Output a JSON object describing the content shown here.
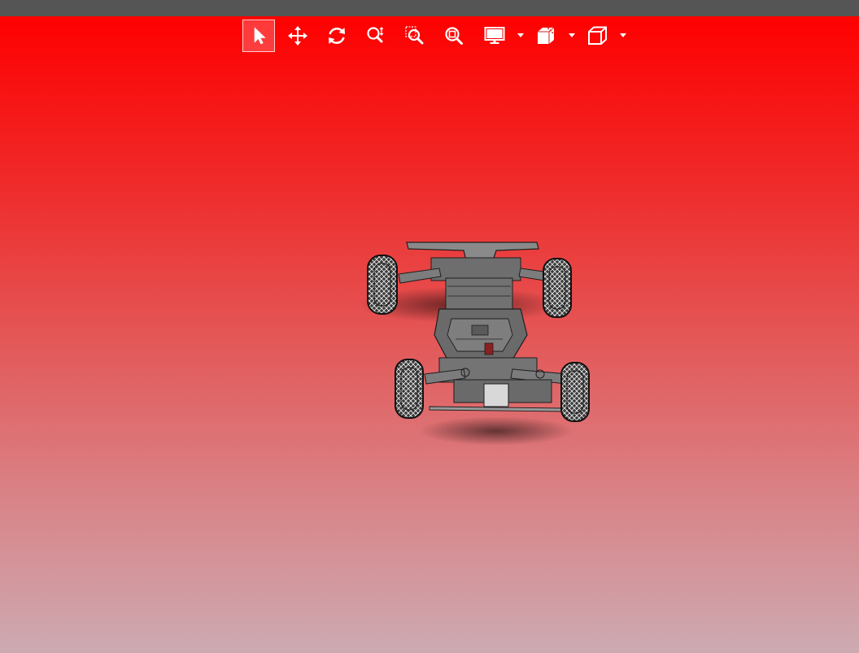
{
  "toolbar": {
    "tools": [
      {
        "name": "select",
        "icon": "select-arrow-icon",
        "active": true
      },
      {
        "name": "pan",
        "icon": "pan-icon"
      },
      {
        "name": "rotate",
        "icon": "rotate-icon"
      },
      {
        "name": "zoom",
        "icon": "zoom-icon"
      },
      {
        "name": "zoom-window",
        "icon": "zoom-window-icon"
      },
      {
        "name": "zoom-fit",
        "icon": "zoom-fit-icon"
      },
      {
        "name": "display-mode",
        "icon": "monitor-icon",
        "dropdown": true
      },
      {
        "name": "section",
        "icon": "section-icon",
        "dropdown": true
      },
      {
        "name": "view-orientation",
        "icon": "cube-icon",
        "dropdown": true
      }
    ]
  },
  "colors": {
    "top_strip": "#555555",
    "gradient_top": "#ff0000",
    "gradient_bottom": "#cdaab2",
    "icon": "#ffffff",
    "model": "#7a7a7a"
  },
  "model": {
    "icon": "rc-car-chassis-model"
  }
}
